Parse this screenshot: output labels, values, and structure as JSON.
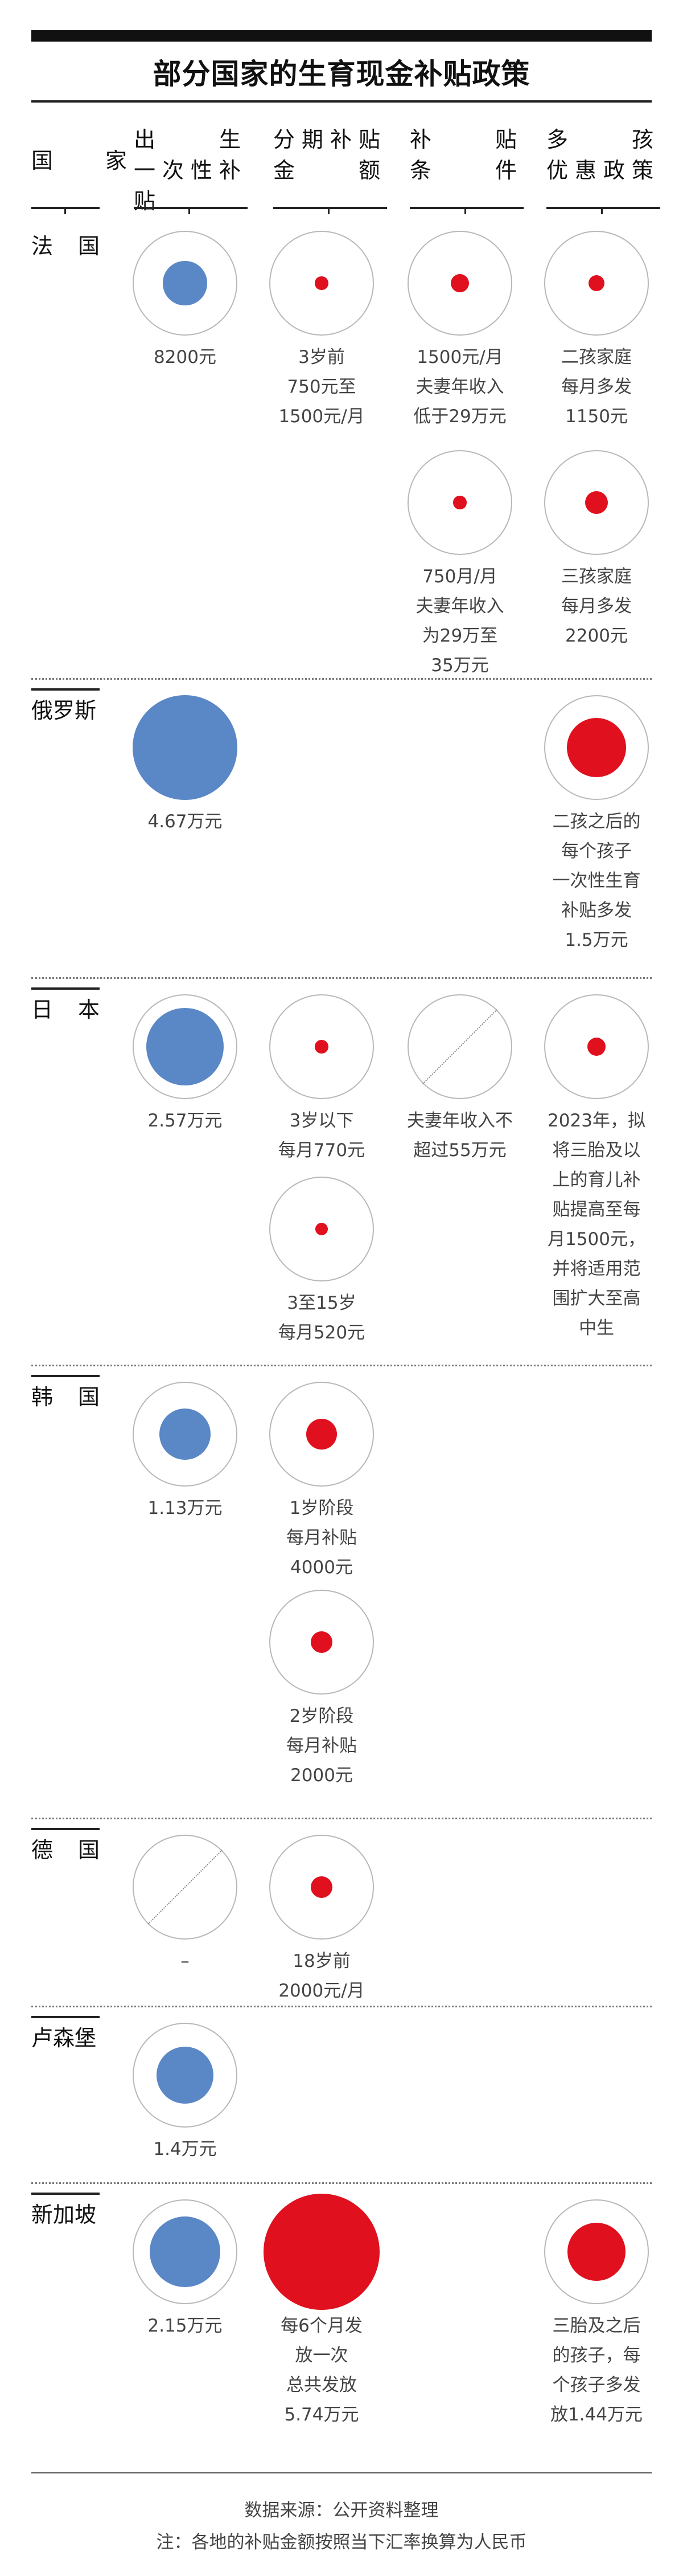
{
  "title": "部分国家的生育现金补贴政策",
  "headers": [
    {
      "l1": "国　家",
      "l2": ""
    },
    {
      "l1": "出　　生",
      "l2": "一次性补贴"
    },
    {
      "l1": "分期补贴",
      "l2": "金　　额"
    },
    {
      "l1": "补　　贴",
      "l2": "条　　件"
    },
    {
      "l1": "多　　孩",
      "l2": "优惠政策"
    }
  ],
  "chart_data": {
    "type": "proportional-symbol table",
    "unit": "元 (人民币)",
    "columns": [
      "国家",
      "出生一次性补贴",
      "分期补贴金额",
      "补贴条件",
      "多孩优惠政策"
    ],
    "rows": [
      {
        "country": "法 国",
        "cells": [
          {
            "col": 1,
            "color": "blue",
            "value": 8200,
            "label": [
              "8200元"
            ]
          },
          {
            "col": 2,
            "color": "red",
            "value": 750,
            "label": [
              "3岁前",
              "750元至",
              "1500元/月"
            ]
          },
          {
            "col": 3,
            "color": "red",
            "value": 1500,
            "label": [
              "1500元/月",
              "夫妻年收入",
              "低于29万元"
            ]
          },
          {
            "col": 4,
            "color": "red",
            "value": 1150,
            "label": [
              "二孩家庭",
              "每月多发",
              "1150元"
            ]
          },
          {
            "col": 3,
            "color": "red",
            "value": 750,
            "label": [
              "750月/月",
              "夫妻年收入",
              "为29万至",
              "35万元"
            ]
          },
          {
            "col": 4,
            "color": "red",
            "value": 2200,
            "label": [
              "三孩家庭",
              "每月多发",
              "2200元"
            ]
          }
        ]
      },
      {
        "country": "俄罗斯",
        "cells": [
          {
            "col": 1,
            "color": "blue",
            "value": 46700,
            "label": [
              "4.67万元"
            ]
          },
          {
            "col": 4,
            "color": "red",
            "value": 15000,
            "label": [
              "二孩之后的",
              "每个孩子",
              "一次性生育",
              "补贴多发",
              "1.5万元"
            ]
          }
        ]
      },
      {
        "country": "日 本",
        "cells": [
          {
            "col": 1,
            "color": "blue",
            "value": 25700,
            "label": [
              "2.57万元"
            ]
          },
          {
            "col": 2,
            "color": "red",
            "value": 770,
            "label": [
              "3岁以下",
              "每月770元"
            ]
          },
          {
            "col": 3,
            "color": "none",
            "value": null,
            "label": [
              "夫妻年收入不",
              "超过55万元"
            ]
          },
          {
            "col": 4,
            "color": "red",
            "value": 1500,
            "label": [
              "2023年，拟",
              "将三胎及以",
              "上的育儿补",
              "贴提高至每",
              "月1500元，",
              "并将适用范",
              "围扩大至高",
              "中生"
            ]
          },
          {
            "col": 2,
            "color": "red",
            "value": 520,
            "label": [
              "3至15岁",
              "每月520元"
            ]
          }
        ]
      },
      {
        "country": "韩 国",
        "cells": [
          {
            "col": 1,
            "color": "blue",
            "value": 11300,
            "label": [
              "1.13万元"
            ]
          },
          {
            "col": 2,
            "color": "red",
            "value": 4000,
            "label": [
              "1岁阶段",
              "每月补贴",
              "4000元"
            ]
          },
          {
            "col": 2,
            "color": "red",
            "value": 2000,
            "label": [
              "2岁阶段",
              "每月补贴",
              "2000元"
            ]
          }
        ]
      },
      {
        "country": "德 国",
        "cells": [
          {
            "col": 1,
            "color": "none",
            "value": null,
            "label": [
              "–"
            ]
          },
          {
            "col": 2,
            "color": "red",
            "value": 2000,
            "label": [
              "18岁前",
              "2000元/月"
            ]
          }
        ]
      },
      {
        "country": "卢森堡",
        "cells": [
          {
            "col": 1,
            "color": "blue",
            "value": 14000,
            "label": [
              "1.4万元"
            ]
          }
        ]
      },
      {
        "country": "新加坡",
        "cells": [
          {
            "col": 1,
            "color": "blue",
            "value": 21500,
            "label": [
              "2.15万元"
            ]
          },
          {
            "col": 2,
            "color": "red",
            "value": 57400,
            "label": [
              "每6个月发",
              "放一次",
              "总共发放",
              "5.74万元"
            ]
          },
          {
            "col": 4,
            "color": "red",
            "value": 14400,
            "label": [
              "三胎及之后",
              "的孩子，每",
              "个孩子多发",
              "放1.44万元"
            ]
          }
        ]
      }
    ]
  },
  "footer": {
    "source": "数据来源：公开资料整理",
    "note": "注：各地的补贴金额按照当下汇率换算为人民币"
  }
}
